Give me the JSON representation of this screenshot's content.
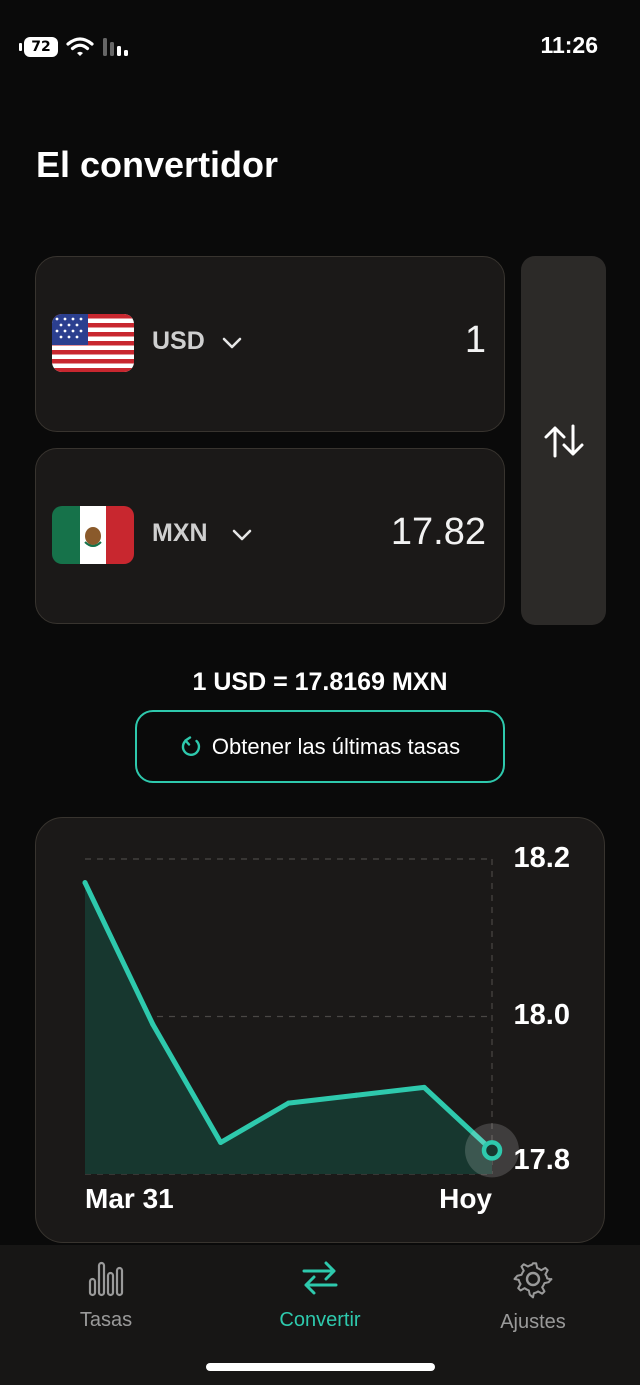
{
  "status": {
    "battery": "72",
    "time": "11:26"
  },
  "page": {
    "title": "El convertidor"
  },
  "from_currency": {
    "code": "USD",
    "amount": "1",
    "flag": "us-flag-icon"
  },
  "to_currency": {
    "code": "MXN",
    "amount": "17.82",
    "flag": "mx-flag-icon"
  },
  "rate": {
    "text": "1 USD = 17.8169 MXN"
  },
  "refresh": {
    "label": "Obtener las últimas tasas"
  },
  "colors": {
    "accent": "#2ec9ad",
    "card": "#1b1918",
    "background": "#0a0a0a"
  },
  "chart_data": {
    "type": "area",
    "x": [
      "Mar 31",
      "",
      "",
      "",
      "",
      "",
      "Hoy"
    ],
    "values": [
      18.17,
      17.99,
      17.84,
      17.89,
      17.9,
      17.91,
      17.83
    ],
    "xtick_labels": [
      "Mar 31",
      "Hoy"
    ],
    "ytick_labels": [
      "18.2",
      "18.0",
      "17.8"
    ],
    "yticks": [
      18.2,
      18.0,
      17.8
    ],
    "ylim": [
      17.8,
      18.2
    ],
    "grid": true,
    "y_axis_side": "right"
  },
  "tabs": [
    {
      "label": "Tasas",
      "icon": "bar-chart-icon",
      "active": false
    },
    {
      "label": "Convertir",
      "icon": "swap-arrows-icon",
      "active": true
    },
    {
      "label": "Ajustes",
      "icon": "gear-icon",
      "active": false
    }
  ]
}
